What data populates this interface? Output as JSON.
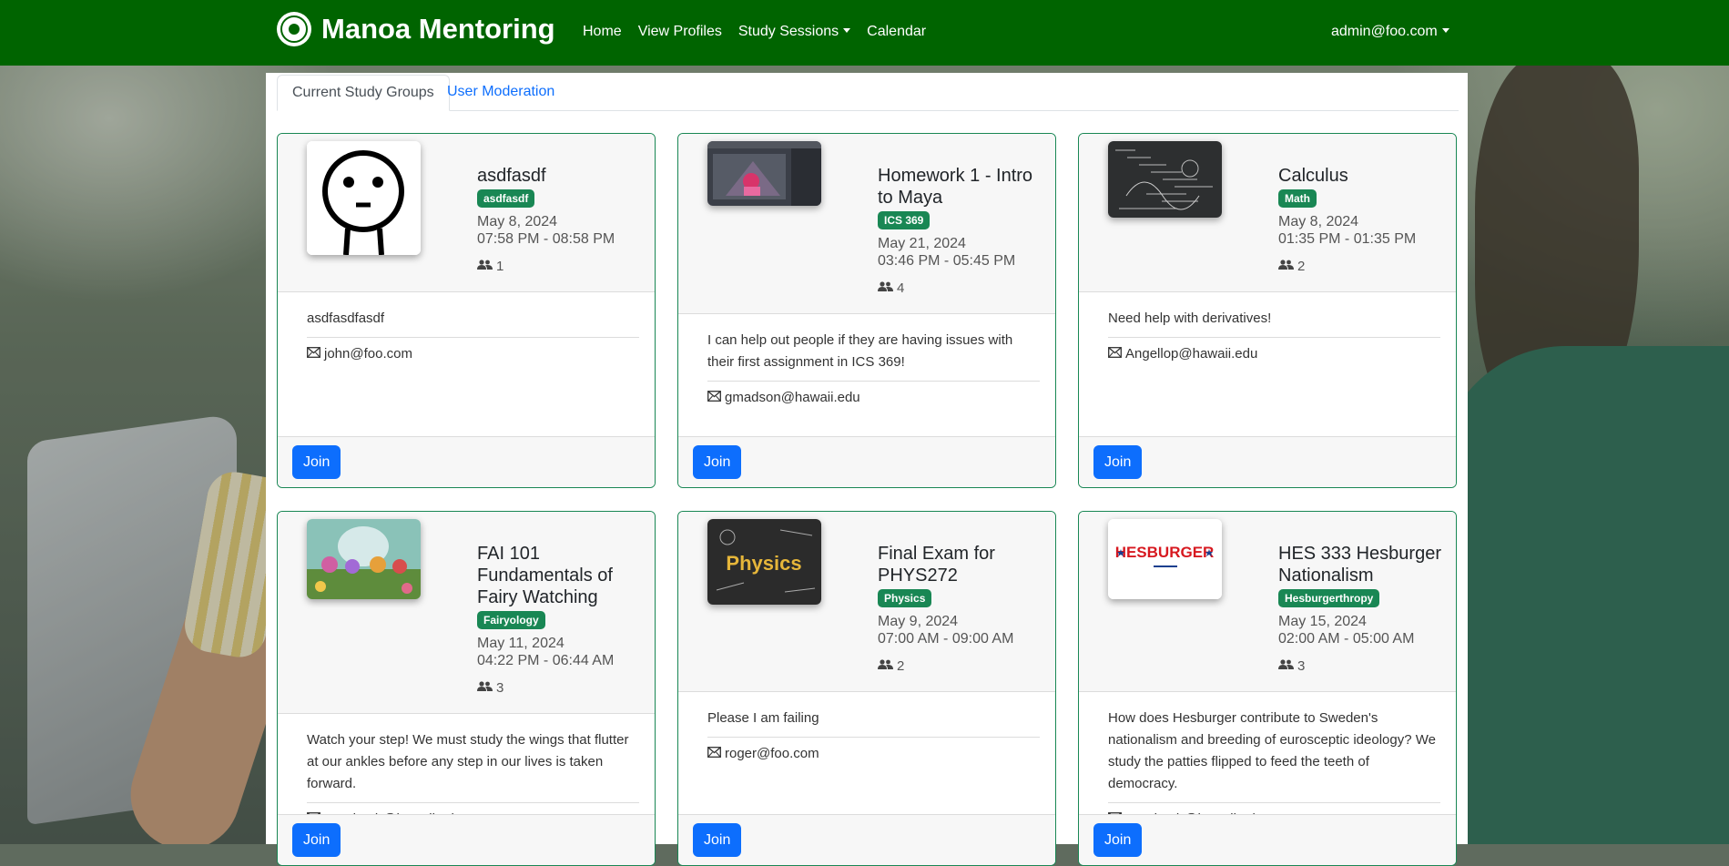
{
  "navbar": {
    "brand": "Manoa Mentoring",
    "links": [
      {
        "label": "Home",
        "dropdown": false
      },
      {
        "label": "View Profiles",
        "dropdown": false
      },
      {
        "label": "Study Sessions",
        "dropdown": true
      },
      {
        "label": "Calendar",
        "dropdown": false
      }
    ],
    "user": "admin@foo.com"
  },
  "tabs": {
    "active": "Current Study Groups",
    "other": "User Moderation"
  },
  "colors": {
    "navbar": "#006400",
    "badge": "#198754",
    "card_border": "#198754",
    "join_button": "#0d6efd"
  },
  "join_label": "Join",
  "cards": [
    {
      "title": "asdfasdf",
      "badge": "asdfasdf",
      "date": "May 8, 2024",
      "time": "07:58 PM - 08:58 PM",
      "attendees": "1",
      "description": "asdfasdfasdf",
      "email": "john@foo.com",
      "image": "stick-figure-face"
    },
    {
      "title": "Homework 1 - Intro to Maya",
      "badge": "ICS 369",
      "date": "May 21, 2024",
      "time": "03:46 PM - 05:45 PM",
      "attendees": "4",
      "description": "I can help out people if they are having issues with their first assignment in ICS 369!",
      "email": "gmadson@hawaii.edu",
      "image": "maya-screenshot"
    },
    {
      "title": "Calculus",
      "badge": "Math",
      "date": "May 8, 2024",
      "time": "01:35 PM - 01:35 PM",
      "attendees": "2",
      "description": "Need help with derivatives!",
      "email": "Angellop@hawaii.edu",
      "image": "chalkboard-formulas"
    },
    {
      "title": "FAI 101 Fundamentals of Fairy Watching",
      "badge": "Fairyology",
      "date": "May 11, 2024",
      "time": "04:22 PM - 06:44 AM",
      "attendees": "3",
      "description": "Watch your step! We must study the wings that flutter at our ankles before any step in our lives is taken forward.",
      "email": "nyezhasb@hawaii.edu",
      "image": "fairies-painting"
    },
    {
      "title": "Final Exam for PHYS272",
      "badge": "Physics",
      "date": "May 9, 2024",
      "time": "07:00 AM - 09:00 AM",
      "attendees": "2",
      "description": "Please I am failing",
      "email": "roger@foo.com",
      "image": "physics-chalkboard",
      "image_text": "Physics"
    },
    {
      "title": "HES 333 Hesburger Nationalism",
      "badge": "Hesburgerthropy",
      "date": "May 15, 2024",
      "time": "02:00 AM - 05:00 AM",
      "attendees": "3",
      "description": "How does Hesburger contribute to Sweden's nationalism and breeding of eurosceptic ideology? We study the patties flipped to feed the teeth of democracy.",
      "email": "nyezhasb@hawaii.edu",
      "image": "hesburger-logo",
      "image_text": "HESBURGER"
    }
  ]
}
